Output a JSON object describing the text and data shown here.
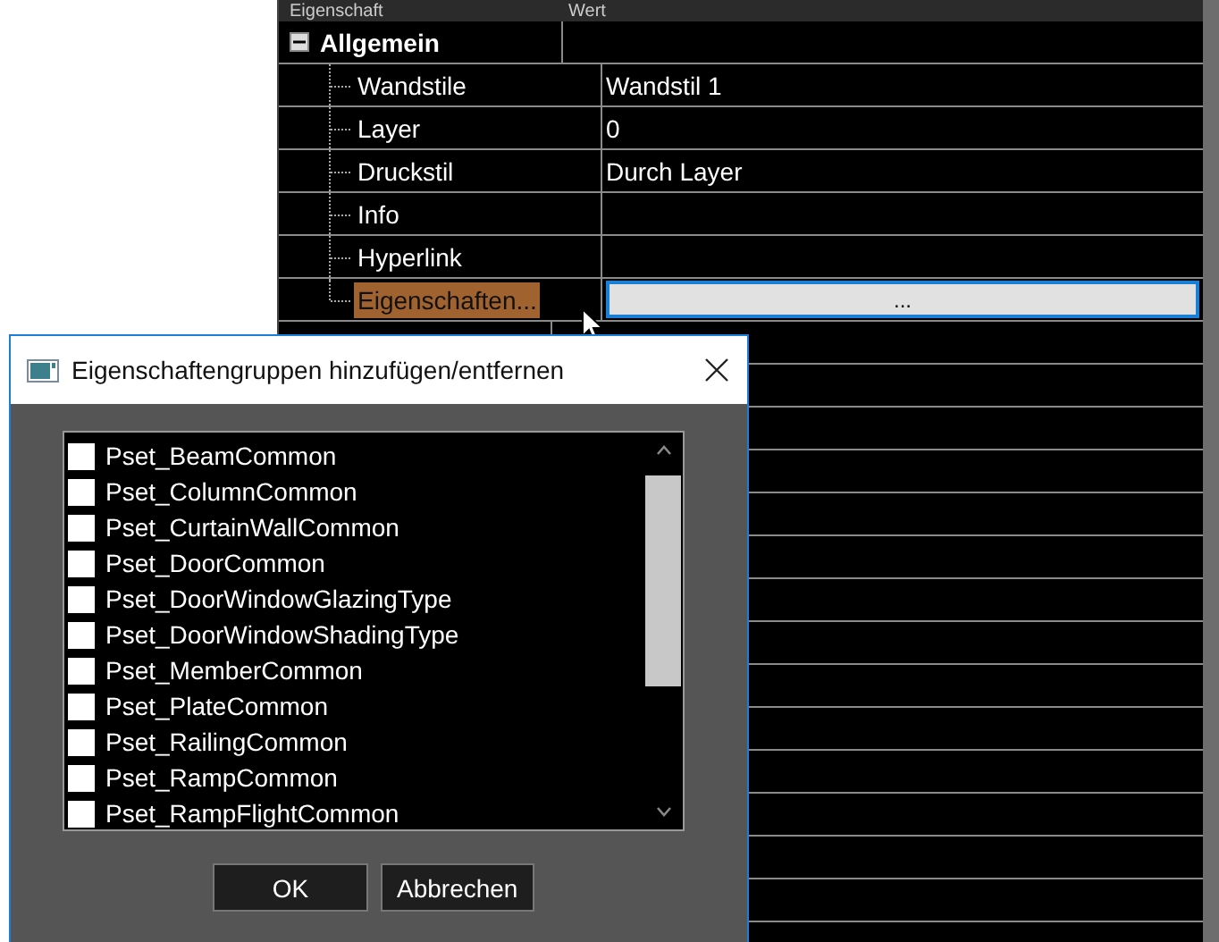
{
  "grid": {
    "columns": [
      "Eigenschaft",
      "Wert"
    ],
    "groups": [
      {
        "label": "Allgemein",
        "expanded": true,
        "rows": [
          {
            "name": "Wandstile",
            "value": "Wandstil 1",
            "kind": "text",
            "selected": false
          },
          {
            "name": "Layer",
            "value": "0",
            "kind": "text",
            "selected": false
          },
          {
            "name": "Druckstil",
            "value": "Durch Layer",
            "kind": "text",
            "selected": false
          },
          {
            "name": "Info",
            "kind": "text",
            "selected": false
          },
          {
            "name": "Hyperlink",
            "kind": "text",
            "selected": false
          },
          {
            "name": "Eigenschaften...",
            "value": "...",
            "kind": "button",
            "selected": true
          }
        ]
      }
    ]
  },
  "dialog": {
    "title": "Eigenschaftengruppen hinzufügen/entfernen",
    "items": [
      {
        "label": "Pset_BeamCommon",
        "checked": false
      },
      {
        "label": "Pset_ColumnCommon",
        "checked": false
      },
      {
        "label": "Pset_CurtainWallCommon",
        "checked": false
      },
      {
        "label": "Pset_DoorCommon",
        "checked": false
      },
      {
        "label": "Pset_DoorWindowGlazingType",
        "checked": false
      },
      {
        "label": "Pset_DoorWindowShadingType",
        "checked": false
      },
      {
        "label": "Pset_MemberCommon",
        "checked": false
      },
      {
        "label": "Pset_PlateCommon",
        "checked": false
      },
      {
        "label": "Pset_RailingCommon",
        "checked": false
      },
      {
        "label": "Pset_RampCommon",
        "checked": false
      },
      {
        "label": "Pset_RampFlightCommon",
        "checked": false
      }
    ],
    "buttons": [
      "OK",
      "Abbrechen"
    ]
  }
}
